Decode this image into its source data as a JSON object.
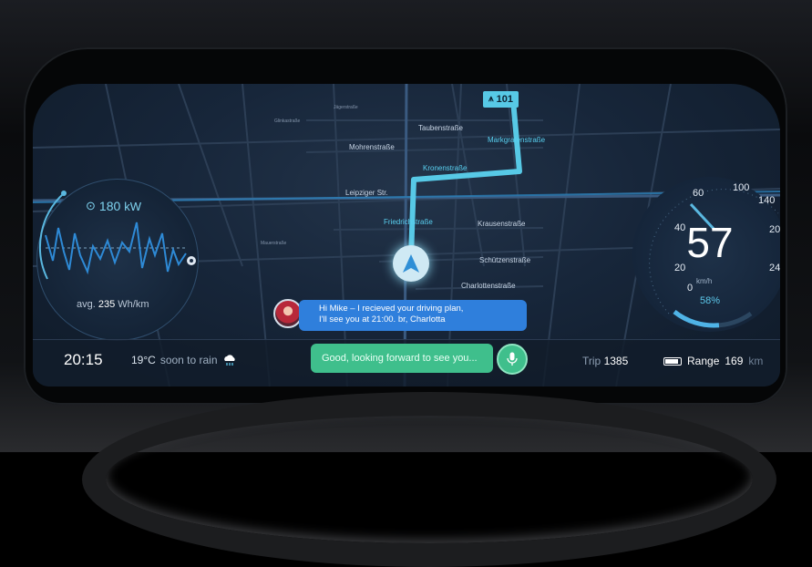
{
  "navigation": {
    "highway_label": "101",
    "streets": {
      "jagerstrasse": "Jägerstraße",
      "glinkastrasse": "Glinkastraße",
      "taubenstrasse": "Taubenstraße",
      "markgrafenstrasse": "Markgrafenstraße",
      "mohrenstrasse": "Mohrenstraße",
      "kronenstrasse": "Kronenstraße",
      "leipziger": "Leipziger Str.",
      "friedrichstrasse": "Friedrichstraße",
      "krausenstrasse": "Krausenstraße",
      "mauerstrasse": "Mauerstraße",
      "schutzenstrasse": "Schützenstraße",
      "charlottenstrasse": "Charlottenstraße"
    }
  },
  "power": {
    "value": "180",
    "unit": "kW",
    "avg_prefix": "avg.",
    "avg_value": "235",
    "avg_unit": "Wh/km"
  },
  "speedometer": {
    "speed": "57",
    "unit": "km/h",
    "ticks": [
      "0",
      "20",
      "40",
      "60",
      "100",
      "140",
      "200",
      "240"
    ],
    "battery_percent": "58%",
    "battery_level": 0.58
  },
  "message": {
    "text_line1": "Hi Mike – I recieved your driving plan,",
    "text_line2": "I'll see you at 21:00. br, Charlotta"
  },
  "status_bar": {
    "time": "20:15",
    "temperature": "19°C",
    "forecast": "soon to rain",
    "reply_text": "Good, looking forward to see you...",
    "trip_label": "Trip",
    "trip_value": "1385",
    "range_label": "Range",
    "range_value": "169",
    "range_unit": "km"
  },
  "colors": {
    "route": "#57c9e6",
    "message": "#2f7fdc",
    "reply": "#3fbf8c"
  }
}
